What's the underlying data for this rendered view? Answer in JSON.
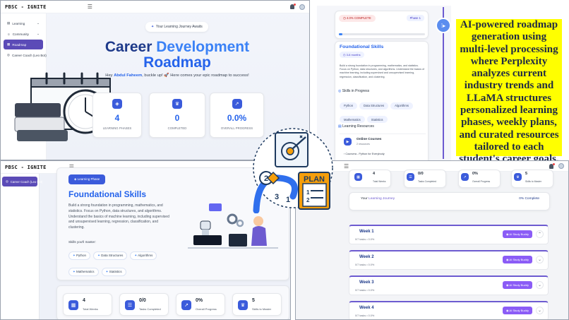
{
  "app": {
    "logo": "PBSC - IGNITE"
  },
  "panel1": {
    "sidebar": [
      {
        "label": "Learning",
        "caret": "⌄"
      },
      {
        "label": "Community",
        "caret": "⌄"
      },
      {
        "label": "Roadmap"
      },
      {
        "label": "Career Coach (Leo Bot)"
      }
    ],
    "pill": "Your Learning Journey Awaits",
    "title_line1_a": "Career ",
    "title_line1_b": "Development",
    "title_line2": "Roadmap",
    "greet_prefix": "Hey ",
    "greet_name": "Abdul Faheem",
    "greet_suffix": ", buckle up! 🚀 Here comes your epic roadmap to success!",
    "stats": [
      {
        "value": "4",
        "label": "LEARNING PHASES"
      },
      {
        "value": "0",
        "label": "COMPLETED"
      },
      {
        "value": "0.0%",
        "label": "OVERALL PROGRESS"
      }
    ]
  },
  "panel2": {
    "complete": "4.0% COMPLETE",
    "phase": "Phase 1",
    "progress_fraction": 0.04,
    "title": "Foundational Skills",
    "duration": "3-6 months",
    "desc": "Build a strong foundation in programming, mathematics, and statistics. Focus on Python, data structures, and algorithms. Understand the basics of machine learning, including supervised and unsupervised learning, regression, classification, and clustering.",
    "skills_heading": "Skills in Progress",
    "skills": [
      "Python",
      "Data Structures",
      "Algorithms",
      "Mathematics",
      "Statistics"
    ],
    "resources_heading": "Learning Resources",
    "res_title": "Online Courses",
    "res_count": "2 resources",
    "res_item": "Coursera - Python for Everybody"
  },
  "callout": "AI-powered roadmap generation using multi-level processing where Perplexity analyzes current industry trends and LLaMA structures personalized learning phases, weekly plans, and curated resources tailored to each student's career goals.",
  "panel3": {
    "sidebar_active": "Career Coach (Leo Bot)",
    "phase_btn": "Learning Phase",
    "title": "Foundational Skills",
    "desc": "Build a strong foundation in programming, mathematics, and statistics. Focus on Python, data structures, and algorithms. Understand the basics of machine learning, including supervised and unsupervised learning, regression, classification, and clustering.",
    "skills_label": "Skills you'll master:",
    "skills": [
      "Python",
      "Data Structures",
      "Algorithms",
      "Mathematics",
      "Statistics"
    ],
    "stats": [
      {
        "value": "4",
        "label": "Total Weeks"
      },
      {
        "value": "0/0",
        "label": "Tasks Completed"
      },
      {
        "value": "0%",
        "label": "Overall Progress"
      },
      {
        "value": "5",
        "label": "Skills to Master"
      }
    ]
  },
  "plan_label": "PLAN",
  "plan_steps": [
    "2",
    "3",
    "1",
    "1",
    "2"
  ],
  "panel4": {
    "stats": [
      {
        "value": "4",
        "label": "Total Weeks"
      },
      {
        "value": "0/0",
        "label": "Tasks Completed"
      },
      {
        "value": "0%",
        "label": "Overall Progress"
      },
      {
        "value": "5",
        "label": "Skills to Master"
      }
    ],
    "journey_a": "Your ",
    "journey_b": "Learning Journey",
    "journey_pct": "0% Complete",
    "weeks": [
      {
        "title": "Week 1",
        "sub": "0/7 tasks • 0.0%",
        "btn": "AI Study Buddy",
        "chev": "⌃"
      },
      {
        "title": "Week 2",
        "sub": "0/7 tasks • 0.0%",
        "btn": "AI Study Buddy",
        "chev": "⌄"
      },
      {
        "title": "Week 3",
        "sub": "0/7 tasks • 0.0%",
        "btn": "AI Study Buddy",
        "chev": "⌄"
      },
      {
        "title": "Week 4",
        "sub": "0/7 tasks • 0.0%",
        "btn": "AI Study Buddy",
        "chev": "⌄"
      }
    ]
  },
  "colors": {
    "primary": "#3b5bdb",
    "accent": "#5b4bb7",
    "buddy": "#8b5cf6",
    "highlight": "#ffff00"
  },
  "icons": [
    "menu-icon",
    "bell-icon",
    "avatar-icon",
    "layers-icon",
    "trophy-icon",
    "chart-icon",
    "sparkle-icon",
    "clock-icon",
    "target-icon",
    "book-icon",
    "play-icon",
    "star-icon"
  ]
}
